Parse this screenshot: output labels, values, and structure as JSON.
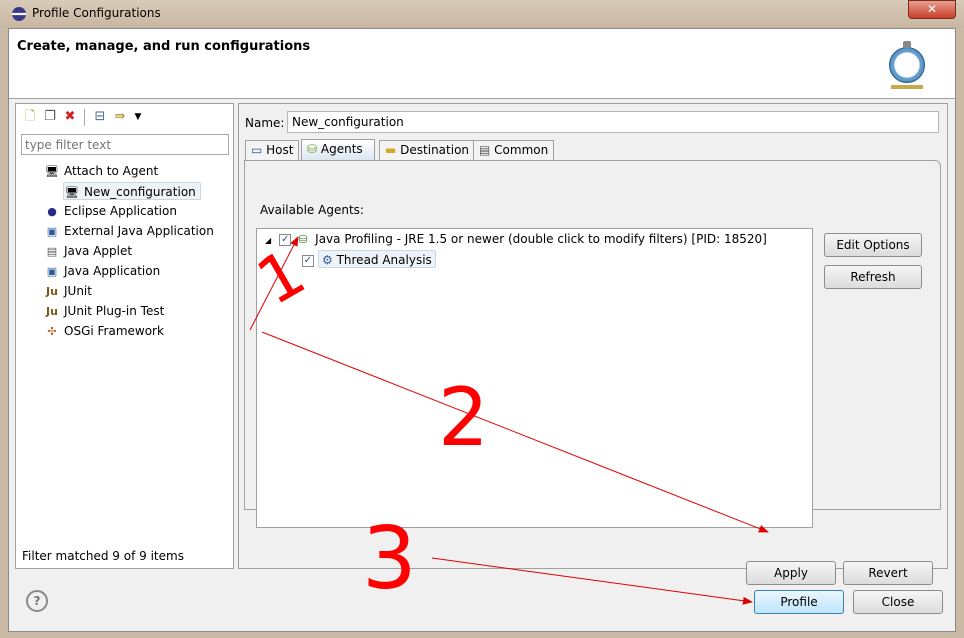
{
  "window": {
    "title": "Profile Configurations",
    "close": "✕"
  },
  "header": {
    "title": "Create, manage, and run configurations"
  },
  "left": {
    "filter_placeholder": "type filter text",
    "items": [
      {
        "label": "Attach to Agent",
        "icon": "attach-agent-icon"
      },
      {
        "label": "New_configuration",
        "icon": "attach-agent-icon"
      },
      {
        "label": "Eclipse Application",
        "icon": "eclipse-icon"
      },
      {
        "label": "External Java Application",
        "icon": "java-app-icon"
      },
      {
        "label": "Java Applet",
        "icon": "applet-icon"
      },
      {
        "label": "Java Application",
        "icon": "java-app-icon"
      },
      {
        "label": "JUnit",
        "icon": "junit-icon"
      },
      {
        "label": "JUnit Plug-in Test",
        "icon": "junit-icon"
      },
      {
        "label": "OSGi Framework",
        "icon": "osgi-icon"
      }
    ],
    "status": "Filter matched 9 of 9 items"
  },
  "right": {
    "name_label": "Name:",
    "name_value": "New_configuration",
    "tabs": [
      "Host",
      "Agents",
      "Destination",
      "Common"
    ],
    "available_label": "Available Agents:",
    "agent": "Java Profiling - JRE 1.5 or newer (double click to modify filters) [PID: 18520]",
    "sub_agent": "Thread Analysis",
    "edit_options": "Edit Options",
    "refresh": "Refresh",
    "apply": "Apply",
    "revert": "Revert"
  },
  "footer": {
    "help": "?",
    "profile": "Profile",
    "close": "Close"
  },
  "annotations": {
    "n1": "1",
    "n2": "2",
    "n3": "3",
    "color": "#e00000"
  }
}
